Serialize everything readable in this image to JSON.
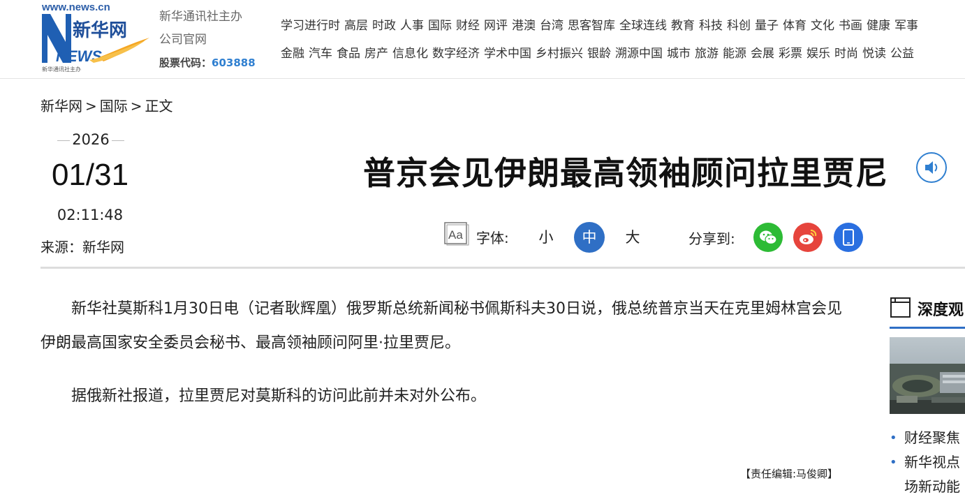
{
  "header": {
    "logo": {
      "url_text": "www.news.cn",
      "brand_cn": "新华网",
      "brand_en": "NEWS",
      "tagline": "新华通讯社主办"
    },
    "org_line1": "新华通讯社主办",
    "org_line2": "公司官网",
    "stock_label": "股票代码：",
    "stock_code": "603888",
    "nav_row1": [
      "学习进行时",
      "高层",
      "时政",
      "人事",
      "国际",
      "财经",
      "网评",
      "港澳",
      "台湾",
      "思客智库",
      "全球连线",
      "教育",
      "科技",
      "科创",
      "量子",
      "体育",
      "文化",
      "书画",
      "健康",
      "军事"
    ],
    "nav_row2": [
      "金融",
      "汽车",
      "食品",
      "房产",
      "信息化",
      "数字经济",
      "学术中国",
      "乡村振兴",
      "银龄",
      "溯源中国",
      "城市",
      "旅游",
      "能源",
      "会展",
      "彩票",
      "娱乐",
      "时尚",
      "悦读",
      "公益"
    ]
  },
  "breadcrumb": {
    "home": "新华网",
    "section": "国际",
    "current": "正文",
    "separator": ">"
  },
  "meta": {
    "year": "2026",
    "month_day": "01/31",
    "time": "02:11:48",
    "source": "来源：新华网"
  },
  "article": {
    "title": "普京会见伊朗最高领袖顾问拉里贾尼",
    "paragraphs": [
      "新华社莫斯科1月30日电（记者耿辉凰）俄罗斯总统新闻秘书佩斯科夫30日说，俄总统普京当天在克里姆林宫会见伊朗最高国家安全委员会秘书、最高领袖顾问阿里·拉里贾尼。",
      "据俄新社报道，拉里贾尼对莫斯科的访问此前并未对外公布。"
    ],
    "editor": "【责任编辑:马俊卿】"
  },
  "toolbar": {
    "font_label": "字体:",
    "font_sizes": {
      "small": "小",
      "medium": "中",
      "large": "大"
    },
    "selected_size": "medium",
    "share_label": "分享到:",
    "share_targets": [
      "wechat-icon",
      "weibo-icon",
      "mobile-icon"
    ]
  },
  "sidebar": {
    "heading": "深度观",
    "items": [
      "财经聚焦",
      "新华视点"
    ],
    "item2_continuation": "场新动能"
  },
  "colors": {
    "accent_blue": "#2f6fc5",
    "link_blue": "#2f7fd0",
    "wechat_green": "#2dbb35",
    "weibo_red": "#e6443c",
    "mobile_blue": "#2a6fe0",
    "logo_orange": "#f5a623"
  }
}
